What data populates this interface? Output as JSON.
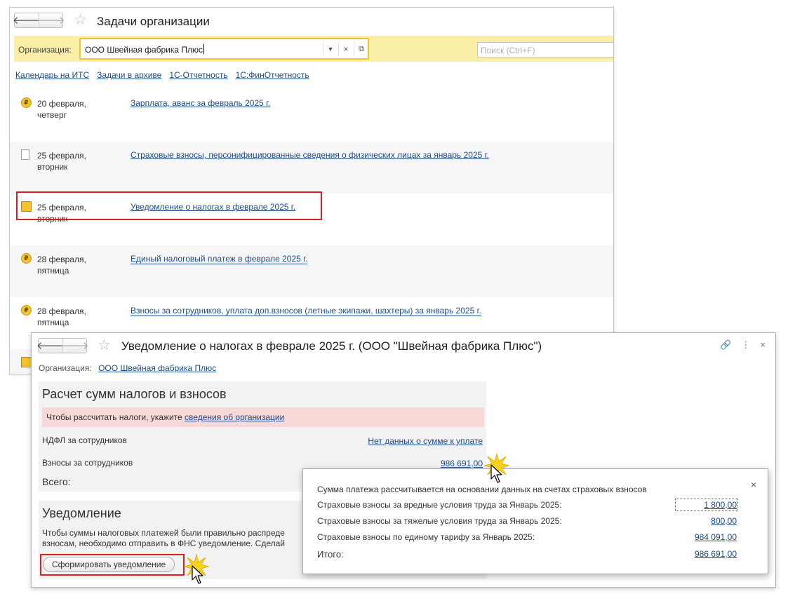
{
  "window1": {
    "title": "Задачи организации",
    "org_label": "Организация:",
    "org_value": "ООО Швейная фабрика Плюс",
    "search_placeholder": "Поиск (Ctrl+F)",
    "links": [
      "Календарь на ИТС",
      "Задачи в архиве",
      "1С-Отчетность",
      "1С:ФинОтчетность"
    ],
    "tasks": [
      {
        "date1": "20 февраля,",
        "date2": "четверг",
        "title": "Зарплата, аванс за февраль 2025 г.",
        "icon": "coin-doc-icon"
      },
      {
        "date1": "25 февраля,",
        "date2": "вторник",
        "title": "Страховые взносы, персонифицированные сведения о физических лицах за январь 2025 г.",
        "icon": "document-icon"
      },
      {
        "date1": "25 февраля,",
        "date2": "вторник",
        "title": "Уведомление о налогах в феврале 2025 г.",
        "icon": "envelope-coin-icon"
      },
      {
        "date1": "28 февраля,",
        "date2": "пятница",
        "title": "Единый налоговый платеж в феврале 2025 г.",
        "icon": "coin-icon"
      },
      {
        "date1": "28 февраля,",
        "date2": "пятница",
        "title": "Взносы за сотрудников, уплата доп.взносов (летные экипажи, шахтеры) за январь 2025 г.",
        "icon": "coin-icon"
      }
    ]
  },
  "window2": {
    "title": "Уведомление о налогах в феврале 2025 г. (ООО \"Швейная фабрика Плюс\")",
    "org_label": "Организация:",
    "org_value": "ООО Швейная фабрика Плюс",
    "calc": {
      "title": "Расчет сумм налогов и взносов",
      "alert_text": "Чтобы рассчитать налоги, укажите",
      "alert_link": "сведения об организации",
      "ndfl_label": "НДФЛ за сотрудников",
      "ndfl_value": "Нет данных о сумме к уплате",
      "contrib_label": "Взносы за сотрудников",
      "contrib_value": "986 691,00",
      "total_label": "Всего:"
    },
    "notice": {
      "title": "Уведомление",
      "text1": "Чтобы суммы налоговых платежей были правильно распреде",
      "text2": "взносам, необходимо отправить в ФНС уведомление. Сделай",
      "button": "Сформировать уведомление"
    }
  },
  "popup": {
    "header": "Сумма платежа рассчитывается на основании данных на счетах страховых взносов",
    "rows": [
      {
        "label": "Страховые взносы за вредные условия труда за Январь 2025:",
        "value": "1 800,00"
      },
      {
        "label": "Страховые взносы за тяжелые условия труда за Январь 2025:",
        "value": "800,00"
      },
      {
        "label": "Страховые взносы по единому тарифу за Январь 2025:",
        "value": "984 091,00"
      }
    ],
    "total_label": "Итого:",
    "total_value": "986 691,00"
  }
}
